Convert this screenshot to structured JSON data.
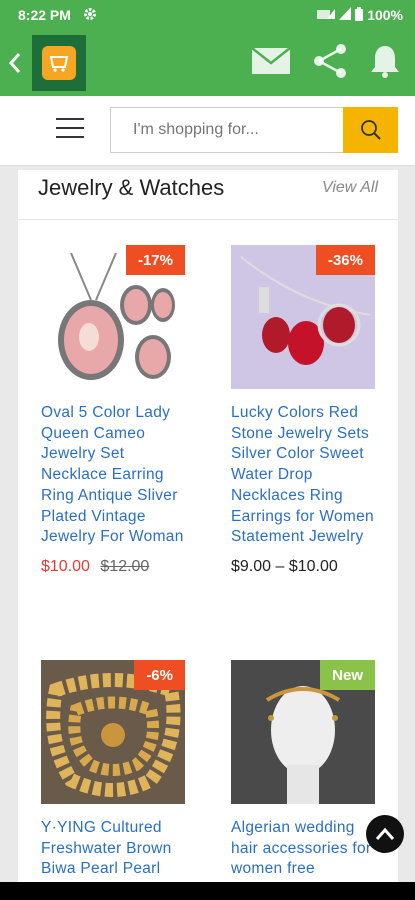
{
  "status_bar": {
    "time": "8:22 PM",
    "battery": "100%"
  },
  "app_bar": {
    "logo": "shop-logo"
  },
  "search": {
    "placeholder": "I'm shopping for..."
  },
  "section": {
    "title": "Jewelry & Watches",
    "view_all": "View All"
  },
  "products": [
    {
      "badge": "-17%",
      "badge_color": "#ef4e23",
      "title": "Oval 5 Color Lady Queen Cameo Jewelry Set Necklace Earring Ring Antique Sliver Plated Vintage Jewelry For Woman",
      "price_sale": "$10.00",
      "price_old": "$12.00"
    },
    {
      "badge": "-36%",
      "badge_color": "#ef4e23",
      "title": "Lucky Colors Red Stone Jewelry Sets Silver Color Sweet Water Drop Necklaces Ring Earrings for Women Statement Jewelry",
      "price_range": "$9.00 – $10.00"
    },
    {
      "badge": "-6%",
      "badge_color": "#ef4e23",
      "title": "Y·YING Cultured Freshwater Brown Biwa Pearl Pearl"
    },
    {
      "badge": "New",
      "badge_color": "#8bc34a",
      "title": "Algerian wedding hair accessories for women free"
    }
  ]
}
